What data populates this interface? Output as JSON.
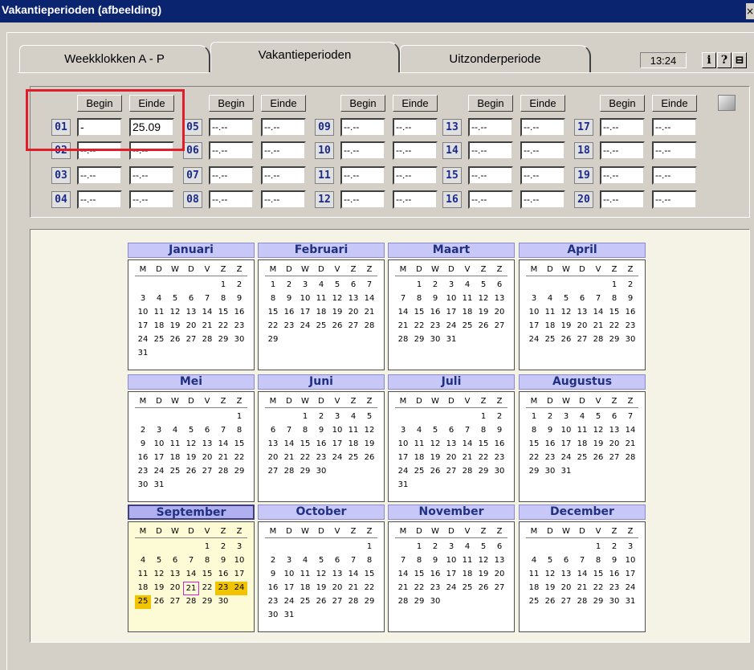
{
  "window": {
    "title": "Vakantieperioden (afbeelding)",
    "close": "×"
  },
  "tabs": [
    "Weekklokken  A - P",
    "Vakantieperioden",
    "Uitzonderperiode"
  ],
  "clock": "13:24",
  "buttons": {
    "info": "i",
    "help": "?",
    "print": "⊟"
  },
  "headers": {
    "begin": "Begin",
    "end": "Einde"
  },
  "periods": [
    {
      "no": "01",
      "begin": "-",
      "end": "25.09"
    },
    {
      "no": "02",
      "begin": "--.--",
      "end": "--.--"
    },
    {
      "no": "03",
      "begin": "--.--",
      "end": "--.--"
    },
    {
      "no": "04",
      "begin": "--.--",
      "end": "--.--"
    },
    {
      "no": "05",
      "begin": "--.--",
      "end": "--.--"
    },
    {
      "no": "06",
      "begin": "--.--",
      "end": "--.--"
    },
    {
      "no": "07",
      "begin": "--.--",
      "end": "--.--"
    },
    {
      "no": "08",
      "begin": "--.--",
      "end": "--.--"
    },
    {
      "no": "09",
      "begin": "--.--",
      "end": "--.--"
    },
    {
      "no": "10",
      "begin": "--.--",
      "end": "--.--"
    },
    {
      "no": "11",
      "begin": "--.--",
      "end": "--.--"
    },
    {
      "no": "12",
      "begin": "--.--",
      "end": "--.--"
    },
    {
      "no": "13",
      "begin": "--.--",
      "end": "--.--"
    },
    {
      "no": "14",
      "begin": "--.--",
      "end": "--.--"
    },
    {
      "no": "15",
      "begin": "--.--",
      "end": "--.--"
    },
    {
      "no": "16",
      "begin": "--.--",
      "end": "--.--"
    },
    {
      "no": "17",
      "begin": "--.--",
      "end": "--.--"
    },
    {
      "no": "18",
      "begin": "--.--",
      "end": "--.--"
    },
    {
      "no": "19",
      "begin": "--.--",
      "end": "--.--"
    },
    {
      "no": "20",
      "begin": "--.--",
      "end": "--.--"
    }
  ],
  "weekday_labels": [
    "M",
    "D",
    "W",
    "D",
    "V",
    "Z",
    "Z"
  ],
  "months": [
    {
      "name": "Januari",
      "offset": 5,
      "days": 31
    },
    {
      "name": "Februari",
      "offset": 0,
      "days": 29
    },
    {
      "name": "Maart",
      "offset": 1,
      "days": 31
    },
    {
      "name": "April",
      "offset": 5,
      "days": 30
    },
    {
      "name": "Mei",
      "offset": 6,
      "days": 31
    },
    {
      "name": "Juni",
      "offset": 2,
      "days": 30
    },
    {
      "name": "Juli",
      "offset": 5,
      "days": 31
    },
    {
      "name": "Augustus",
      "offset": 0,
      "days": 31
    },
    {
      "name": "September",
      "offset": 4,
      "days": 30,
      "selected": true,
      "highlight": [
        23,
        24,
        25
      ],
      "today": 21
    },
    {
      "name": "October",
      "offset": 6,
      "days": 31
    },
    {
      "name": "November",
      "offset": 1,
      "days": 30
    },
    {
      "name": "December",
      "offset": 4,
      "days": 31
    }
  ]
}
